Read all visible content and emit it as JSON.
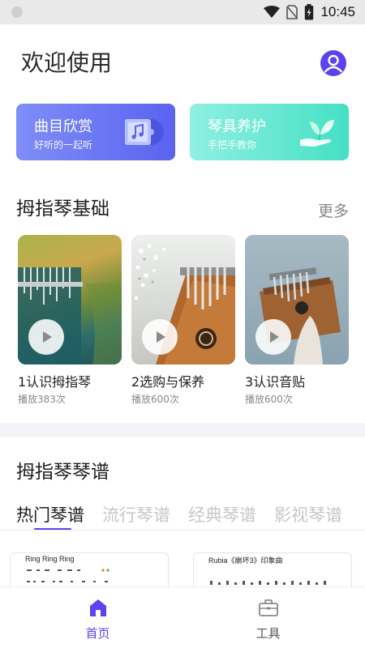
{
  "status_bar": {
    "time": "10:45"
  },
  "header": {
    "title": "欢迎使用"
  },
  "banners": [
    {
      "title": "曲目欣赏",
      "subtitle": "好听的一起听",
      "icon": "music-disc-icon"
    },
    {
      "title": "琴具养护",
      "subtitle": "手把手教你",
      "icon": "hand-leaf-icon"
    }
  ],
  "basics": {
    "title": "拇指琴基础",
    "more": "更多",
    "videos": [
      {
        "title": "1认识拇指琴",
        "plays": "播放383次"
      },
      {
        "title": "2选购与保养",
        "plays": "播放600次"
      },
      {
        "title": "3认识音贴",
        "plays": "播放600次"
      }
    ]
  },
  "scores": {
    "title": "拇指琴琴谱",
    "tabs": [
      "热门琴谱",
      "流行琴谱",
      "经典琴谱",
      "影视琴谱"
    ],
    "active_tab": 0,
    "items": [
      {
        "title": "Ring Ring Ring"
      },
      {
        "title": "Rubia《崩坏3》印象曲"
      }
    ]
  },
  "bottom_nav": {
    "items": [
      {
        "label": "首页",
        "icon": "home-icon",
        "active": true
      },
      {
        "label": "工具",
        "icon": "toolbox-icon",
        "active": false
      }
    ]
  },
  "colors": {
    "accent": "#5b43f0",
    "banner1": "#6f77f2",
    "banner2": "#5ce6cd"
  }
}
